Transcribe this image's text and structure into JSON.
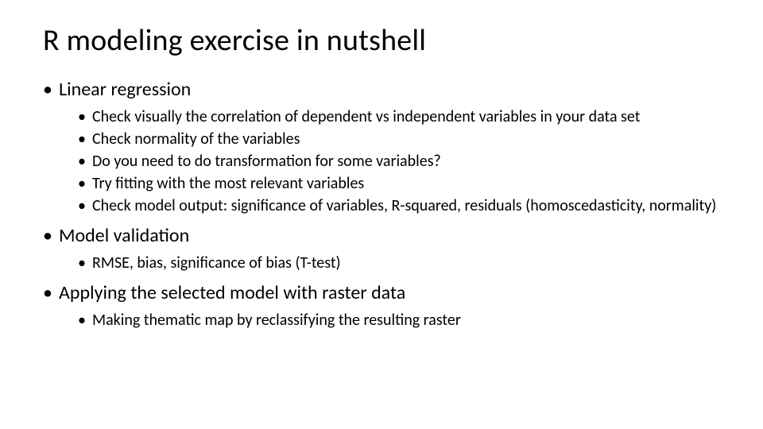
{
  "title": "R modeling exercise in nutshell",
  "items": [
    {
      "label": "Linear regression",
      "children": [
        "Check visually the correlation of dependent vs independent variables in your data set",
        "Check normality of the variables",
        "Do you need to do transformation for some variables?",
        "Try fitting with the most relevant variables",
        "Check model output: significance of variables, R-squared, residuals (homoscedasticity, normality)"
      ]
    },
    {
      "label": "Model validation",
      "children": [
        "RMSE, bias, significance of bias (T-test)"
      ]
    },
    {
      "label": "Applying the selected model with raster data",
      "children": [
        "Making thematic map by reclassifying the resulting raster"
      ]
    }
  ]
}
